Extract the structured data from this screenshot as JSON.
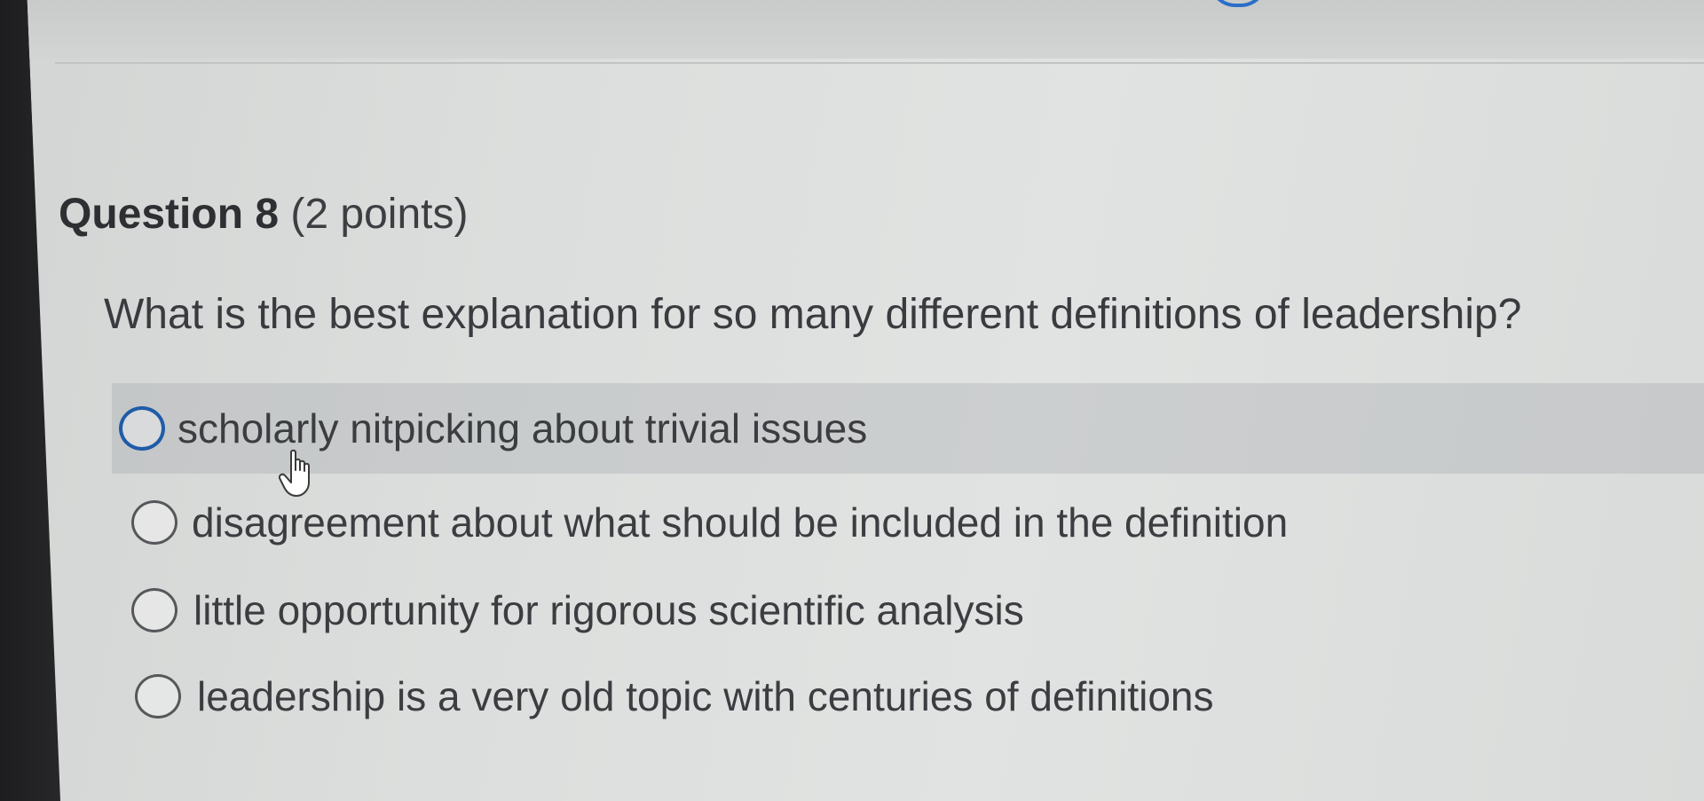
{
  "question": {
    "number_label": "Question 8",
    "points_label": "(2 points)",
    "text": "What is the best explanation for so many different definitions of leadership?"
  },
  "options": [
    {
      "label": "scholarly nitpicking about trivial issues",
      "selected": false,
      "hovered": true
    },
    {
      "label": "disagreement about what should be included in the definition",
      "selected": false,
      "hovered": false
    },
    {
      "label": "little opportunity for rigorous scientific analysis",
      "selected": false,
      "hovered": false
    },
    {
      "label": "leadership is a very old topic with centuries of definitions",
      "selected": false,
      "hovered": false
    }
  ],
  "colors": {
    "accent": "#1f5ca8",
    "text": "#3c3d41",
    "background": "#dcdedd"
  },
  "icons": {
    "cursor": "hand-pointer-icon"
  }
}
